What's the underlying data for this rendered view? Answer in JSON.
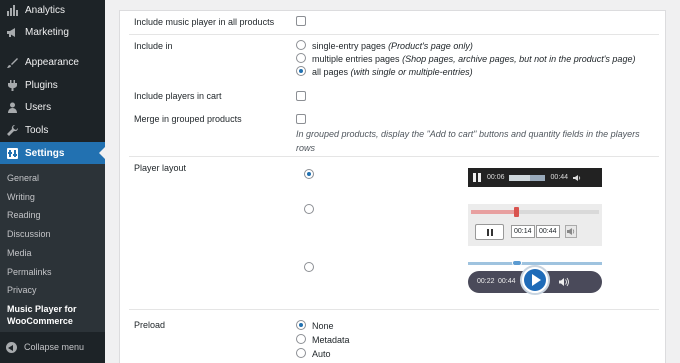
{
  "sidebar": {
    "menu": [
      {
        "label": "Analytics",
        "icon": "bar-chart-icon"
      },
      {
        "label": "Marketing",
        "icon": "megaphone-icon"
      },
      {
        "label": "Appearance",
        "icon": "paintbrush-icon"
      },
      {
        "label": "Plugins",
        "icon": "plug-icon"
      },
      {
        "label": "Users",
        "icon": "user-icon"
      },
      {
        "label": "Tools",
        "icon": "wrench-icon"
      },
      {
        "label": "Settings",
        "icon": "settings-icon"
      }
    ],
    "submenu": [
      "General",
      "Writing",
      "Reading",
      "Discussion",
      "Media",
      "Permalinks",
      "Privacy",
      "Music Player for WooCommerce"
    ],
    "collapse_label": "Collapse menu",
    "accent_color": "#2271b1"
  },
  "settings": {
    "music_player_all_products": {
      "label": "Include music player in all products",
      "checked": false
    },
    "include_in": {
      "label": "Include in",
      "options": [
        {
          "label": "single-entry pages",
          "note": "(Product's page only)",
          "selected": false
        },
        {
          "label": "multiple entries pages",
          "note": "(Shop pages, archive pages, but not in the product's page)",
          "selected": false
        },
        {
          "label": "all pages",
          "note": "(with single or multiple-entries)",
          "selected": true
        }
      ]
    },
    "players_in_cart": {
      "label": "Include players in cart",
      "checked": false
    },
    "grouped_products": {
      "label": "Merge in grouped products",
      "checked": false,
      "help": "In grouped products, display the \"Add to cart\" buttons and quantity fields in the players rows"
    },
    "player_layout": {
      "label": "Player layout",
      "skins": [
        {
          "selected": true,
          "current": "00:06",
          "duration": "00:44"
        },
        {
          "selected": false,
          "current": "00:14",
          "duration": "00:44"
        },
        {
          "selected": false,
          "current": "00:22",
          "duration": "00:44"
        }
      ]
    },
    "preload": {
      "label": "Preload",
      "options": [
        {
          "label": "None",
          "selected": true
        },
        {
          "label": "Metadata",
          "selected": false
        },
        {
          "label": "Auto",
          "selected": false
        }
      ]
    }
  }
}
